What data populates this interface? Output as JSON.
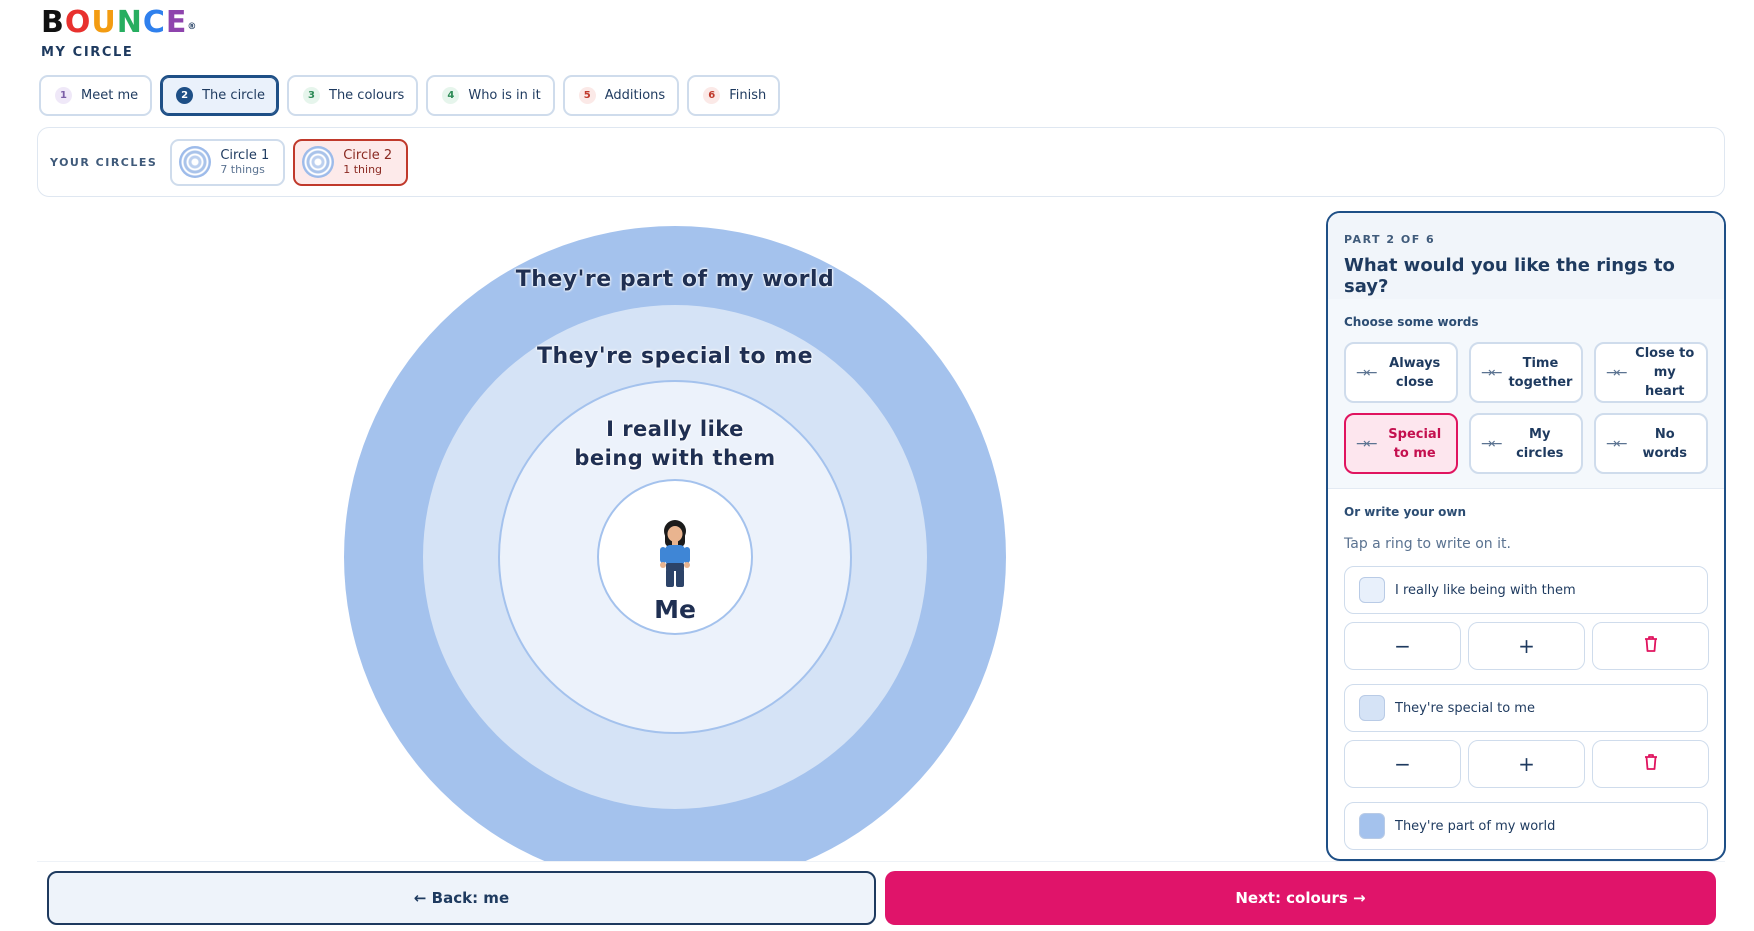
{
  "brand": {
    "letters": [
      {
        "ch": "B",
        "color": "#111111"
      },
      {
        "ch": "O",
        "color": "#e8312e"
      },
      {
        "ch": "U",
        "color": "#f39c12"
      },
      {
        "ch": "N",
        "color": "#27ae60"
      },
      {
        "ch": "C",
        "color": "#2f80ed"
      },
      {
        "ch": "E",
        "color": "#8e44ad"
      }
    ],
    "mark": "®",
    "subtitle": "MY CIRCLE"
  },
  "steps": [
    {
      "num": "1",
      "label": "Meet me",
      "num_color": "#7b5ea7",
      "num_bg": "#efe8f8"
    },
    {
      "num": "2",
      "label": "The circle",
      "num_color": "#ffffff",
      "num_bg": "#1e4f86"
    },
    {
      "num": "3",
      "label": "The colours",
      "num_color": "#2e8b57",
      "num_bg": "#e6f5ec"
    },
    {
      "num": "4",
      "label": "Who is in it",
      "num_color": "#2e8b57",
      "num_bg": "#e6f5ec"
    },
    {
      "num": "5",
      "label": "Additions",
      "num_color": "#c0392b",
      "num_bg": "#fbe9e7"
    },
    {
      "num": "6",
      "label": "Finish",
      "num_color": "#c0392b",
      "num_bg": "#fbe9e7"
    }
  ],
  "active_step": 2,
  "circles": {
    "label": "YOUR CIRCLES",
    "items": [
      {
        "name": "Circle 1",
        "count": "7 things"
      },
      {
        "name": "Circle 2",
        "count": "1 thing"
      }
    ]
  },
  "diagram": {
    "outer_label": "They're part of my world",
    "middle_label": "They're special to me",
    "inner_label_line1": "I really like",
    "inner_label_line2": "being with them",
    "center_label": "Me",
    "colors": {
      "outer": "#a4c2ed",
      "middle": "#d5e3f6",
      "inner": "#ecf2fb"
    }
  },
  "panel": {
    "part": "PART 2 OF 6",
    "question": "What would you like the rings to say?",
    "choose_heading": "Choose some words",
    "words": [
      {
        "line1": "Always",
        "line2": "close"
      },
      {
        "line1": "Time",
        "line2": "together"
      },
      {
        "line1": "Close to",
        "line2": "my heart"
      },
      {
        "line1": "Special",
        "line2": "to me"
      },
      {
        "line1": "My",
        "line2": "circles"
      },
      {
        "line1": "No",
        "line2": "words"
      }
    ],
    "arrows_icon": "→←",
    "own_heading": "Or write your own",
    "own_hint": "Tap a ring to write on it.",
    "rings": [
      {
        "label": "I really like being with them",
        "color": "#e8f0fb"
      },
      {
        "label": "They're special to me",
        "color": "#d5e3f6"
      },
      {
        "label": "They're part of my world",
        "color": "#a4c2ed"
      }
    ],
    "minus": "−",
    "plus": "+"
  },
  "nav": {
    "back": "← Back: me",
    "next": "Next: colours →"
  }
}
